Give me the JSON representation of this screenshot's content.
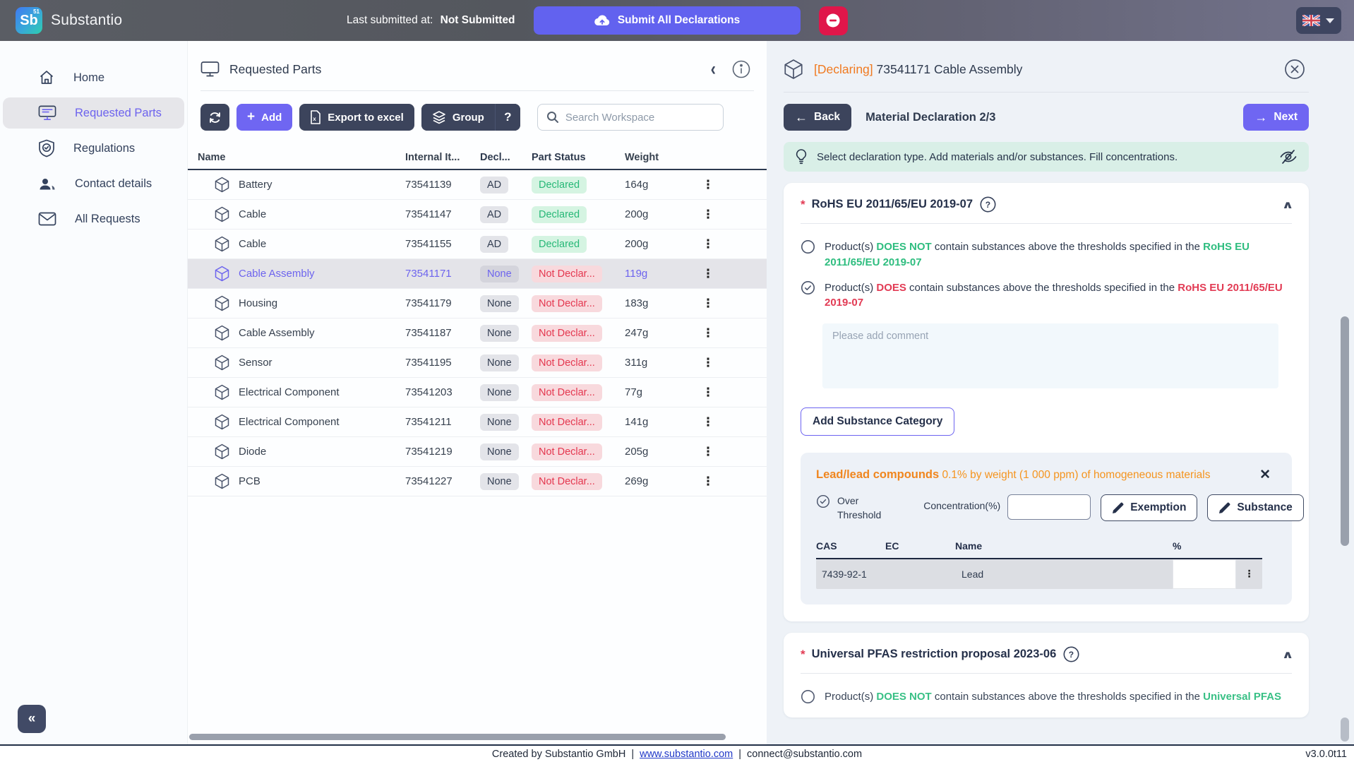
{
  "topbar": {
    "logo_symbol": "Sb",
    "logo_number": "51",
    "brand": "Substantio",
    "last_submitted_label": "Last submitted at:",
    "last_submitted_value": "Not Submitted",
    "submit_all_label": "Submit All Declarations"
  },
  "sidebar": {
    "items": [
      {
        "label": "Home",
        "icon": "home-icon",
        "active": false
      },
      {
        "label": "Requested Parts",
        "icon": "monitor-icon",
        "active": true
      },
      {
        "label": "Regulations",
        "icon": "shield-check-icon",
        "active": false
      },
      {
        "label": "Contact details",
        "icon": "people-icon",
        "active": false
      },
      {
        "label": "All Requests",
        "icon": "mail-icon",
        "active": false
      }
    ],
    "collapse_label": "«"
  },
  "parts_panel": {
    "title": "Requested Parts",
    "toolbar": {
      "add_label": "Add",
      "export_label": "Export to excel",
      "group_label": "Group",
      "help_label": "?",
      "search_placeholder": "Search Workspace"
    },
    "table": {
      "columns": {
        "name": "Name",
        "internal": "Internal It...",
        "decl": "Decl...",
        "status": "Part Status",
        "weight": "Weight"
      },
      "rows": [
        {
          "name": "Battery",
          "internal": "73541139",
          "decl": "AD",
          "status": "Declared",
          "weight": "164g",
          "selected": false,
          "declared": true
        },
        {
          "name": "Cable",
          "internal": "73541147",
          "decl": "AD",
          "status": "Declared",
          "weight": "200g",
          "selected": false,
          "declared": true
        },
        {
          "name": "Cable",
          "internal": "73541155",
          "decl": "AD",
          "status": "Declared",
          "weight": "200g",
          "selected": false,
          "declared": true
        },
        {
          "name": "Cable Assembly",
          "internal": "73541171",
          "decl": "None",
          "status": "Not Declar...",
          "weight": "119g",
          "selected": true,
          "declared": false
        },
        {
          "name": "Housing",
          "internal": "73541179",
          "decl": "None",
          "status": "Not Declar...",
          "weight": "183g",
          "selected": false,
          "declared": false
        },
        {
          "name": "Cable Assembly",
          "internal": "73541187",
          "decl": "None",
          "status": "Not Declar...",
          "weight": "247g",
          "selected": false,
          "declared": false
        },
        {
          "name": "Sensor",
          "internal": "73541195",
          "decl": "None",
          "status": "Not Declar...",
          "weight": "311g",
          "selected": false,
          "declared": false
        },
        {
          "name": "Electrical Component",
          "internal": "73541203",
          "decl": "None",
          "status": "Not Declar...",
          "weight": "77g",
          "selected": false,
          "declared": false
        },
        {
          "name": "Electrical Component",
          "internal": "73541211",
          "decl": "None",
          "status": "Not Declar...",
          "weight": "141g",
          "selected": false,
          "declared": false
        },
        {
          "name": "Diode",
          "internal": "73541219",
          "decl": "None",
          "status": "Not Declar...",
          "weight": "205g",
          "selected": false,
          "declared": false
        },
        {
          "name": "PCB",
          "internal": "73541227",
          "decl": "None",
          "status": "Not Declar...",
          "weight": "269g",
          "selected": false,
          "declared": false
        }
      ]
    }
  },
  "declaration_panel": {
    "header": {
      "tag": "[Declaring]",
      "title": "73541171 Cable Assembly"
    },
    "nav": {
      "back_label": "Back",
      "step_label": "Material Declaration 2/3",
      "next_label": "Next"
    },
    "hint": "Select declaration type. Add materials and/or substances. Fill concentrations.",
    "rohs": {
      "required_mark": "*",
      "title": "RoHS EU 2011/65/EU 2019-07",
      "option_not": {
        "pre": "Product(s) ",
        "verdict": "DOES NOT",
        "mid": " contain substances above the thresholds specified in the ",
        "link": "RoHS EU 2011/65/EU 2019-07"
      },
      "option_does": {
        "pre": "Product(s) ",
        "verdict": "DOES",
        "mid": " contain substances above the thresholds specified in the ",
        "link": "RoHS EU 2011/65/EU 2019-07"
      },
      "comment_placeholder": "Please add comment",
      "add_category_label": "Add Substance Category",
      "substance_category": {
        "name": "Lead/lead compounds",
        "threshold_text": " 0.1% by weight (1 000 ppm) of homogeneous materials",
        "close_label": "✕",
        "over_threshold_label": "Over Threshold",
        "concentration_label": "Concentration(%)",
        "concentration_value": "",
        "exemption_label": "Exemption",
        "substance_label": "Substance",
        "table": {
          "columns": {
            "cas": "CAS",
            "ec": "EC",
            "name": "Name",
            "pct": "%"
          },
          "rows": [
            {
              "cas": "7439-92-1",
              "ec": "",
              "name": "Lead",
              "pct": ""
            }
          ]
        }
      }
    },
    "pfas": {
      "required_mark": "*",
      "title": "Universal PFAS restriction proposal 2023-06",
      "option_not": {
        "pre": "Product(s) ",
        "verdict": "DOES NOT",
        "mid": " contain substances above the thresholds specified in the ",
        "link": "Universal PFAS"
      }
    }
  },
  "footer": {
    "created": "Created by Substantio GmbH",
    "sep1": "|",
    "site": "www.substantio.com",
    "sep2": "|",
    "email": "connect@substantio.com",
    "version": "v3.0.0t11"
  }
}
